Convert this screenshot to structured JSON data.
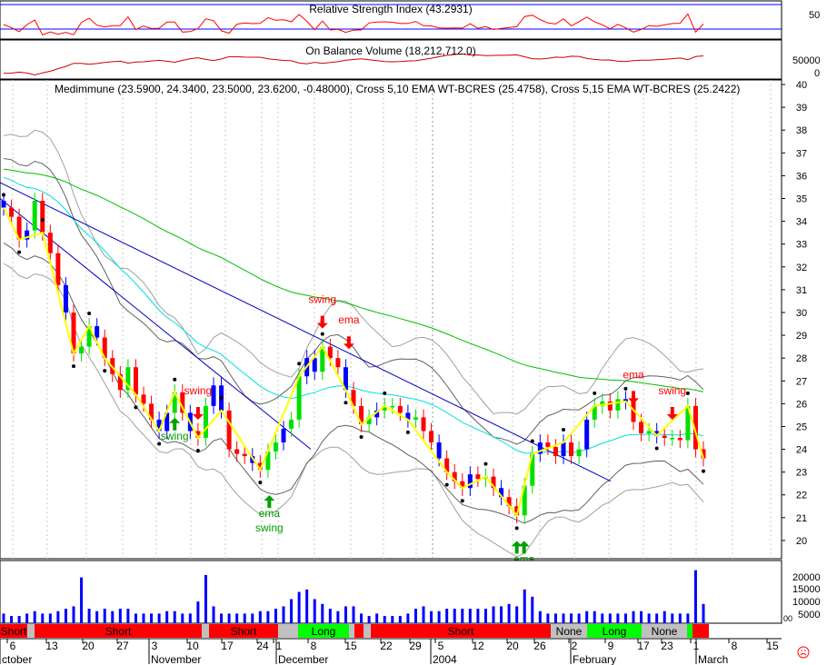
{
  "panels": {
    "rsi": {
      "title": "Relative Strength Index (43.2931)",
      "ticks": [
        "50"
      ]
    },
    "obv": {
      "title": "On Balance Volume (18,212,712.0)",
      "ticks": [
        "50000",
        "0"
      ]
    },
    "price": {
      "title": "Medimmune (23.5900, 24.3400, 23.5000, 23.6200, -0.48000), Cross 5,10 EMA WT-BCRES (25.4758), Cross 5,15 EMA WT-BCRES (25.2422)"
    },
    "volume": {
      "ticks": [
        "20000",
        "15000",
        "10000",
        "5000",
        "00"
      ]
    }
  },
  "signal_bar": {
    "segments": [
      {
        "label": "Short",
        "state": "short"
      },
      {
        "label": "",
        "state": "none"
      },
      {
        "label": "Short",
        "state": "short"
      },
      {
        "label": "",
        "state": "none"
      },
      {
        "label": "Short",
        "state": "short"
      },
      {
        "label": "",
        "state": "none"
      },
      {
        "label": "Long",
        "state": "long"
      },
      {
        "label": "",
        "state": "none"
      },
      {
        "label": "",
        "state": "short"
      },
      {
        "label": "",
        "state": "none"
      },
      {
        "label": "Short",
        "state": "short"
      },
      {
        "label": "None",
        "state": "none"
      },
      {
        "label": "Long",
        "state": "long"
      },
      {
        "label": "None",
        "state": "none"
      },
      {
        "label": "",
        "state": "long"
      },
      {
        "label": "",
        "state": "short"
      }
    ],
    "colors": {
      "short": "#ff0000",
      "long": "#00ff00",
      "none": "#c0c0c0"
    }
  },
  "date_axis": {
    "day_labels": [
      "6",
      "13",
      "20",
      "27",
      "3",
      "10",
      "17",
      "24",
      "1",
      "8",
      "15",
      "22",
      "29",
      "5",
      "12",
      "20",
      "26",
      "2",
      "9",
      "17",
      "23",
      "1",
      "8",
      "15"
    ],
    "month_labels": [
      "ctober",
      "November",
      "December",
      "2004",
      "February",
      "March"
    ]
  },
  "annotations": [
    {
      "text": "swing",
      "color": "#00a000",
      "direction": "up"
    },
    {
      "text": "swing",
      "color": "#ff0000",
      "direction": "down"
    },
    {
      "text": "ema",
      "color": "#00a000",
      "direction": "up"
    },
    {
      "text": "swing",
      "color": "#00a000",
      "direction": ""
    },
    {
      "text": "swing",
      "color": "#ff0000",
      "direction": "down"
    },
    {
      "text": "ema",
      "color": "#ff0000",
      "direction": "down"
    },
    {
      "text": "ema",
      "color": "#00a000",
      "direction": "up"
    },
    {
      "text": "swing",
      "color": "#00a000",
      "direction": "up"
    },
    {
      "text": "ema",
      "color": "#ff0000",
      "direction": "down"
    },
    {
      "text": "swing",
      "color": "#ff0000",
      "direction": "down"
    }
  ],
  "chart_data": {
    "type": "candlestick",
    "title": "Medimmune (23.5900, 24.3400, 23.5000, 23.6200, -0.48000), Cross 5,10 EMA WT-BCRES (25.4758), Cross 5,15 EMA WT-BCRES (25.2422)",
    "y_ticks": [
      20,
      21,
      22,
      23,
      24,
      25,
      26,
      27,
      28,
      29,
      30,
      31,
      32,
      33,
      34,
      35,
      36,
      37,
      38,
      39,
      40
    ],
    "ylim": [
      19.2,
      40.2
    ],
    "close": [
      34.6,
      34.2,
      33.2,
      33.6,
      34.9,
      33.5,
      32.6,
      31.2,
      30.0,
      28.2,
      28.5,
      29.4,
      28.9,
      28.0,
      27.3,
      26.6,
      27.6,
      26.4,
      26.0,
      25.3,
      24.8,
      25.6,
      26.5,
      25.6,
      24.8,
      24.5,
      25.9,
      26.8,
      25.7,
      24.0,
      23.8,
      23.7,
      23.4,
      23.1,
      23.9,
      24.3,
      24.9,
      25.3,
      27.2,
      28.0,
      27.4,
      28.5,
      28.0,
      27.6,
      26.6,
      25.9,
      25.1,
      25.4,
      25.7,
      25.9,
      25.9,
      25.6,
      25.3,
      25.4,
      24.8,
      24.3,
      23.6,
      23.0,
      22.6,
      22.3,
      22.9,
      22.7,
      22.8,
      22.3,
      21.9,
      21.5,
      21.1,
      22.4,
      23.8,
      24.3,
      24.1,
      23.7,
      24.3,
      23.7,
      24.0,
      25.3,
      25.9,
      26.1,
      25.7,
      26.2,
      26.1,
      25.2,
      24.7,
      24.8,
      24.6,
      24.5,
      24.5,
      24.4,
      25.9,
      24.0,
      23.6
    ],
    "volume": [
      4000,
      3000,
      3000,
      4000,
      5000,
      4000,
      4000,
      5000,
      6000,
      7000,
      19000,
      6000,
      5000,
      6000,
      5000,
      6000,
      6000,
      4000,
      4000,
      4000,
      4000,
      5000,
      5000,
      4000,
      4000,
      9000,
      20000,
      7000,
      4000,
      4000,
      4000,
      4000,
      4000,
      5000,
      5000,
      6000,
      7000,
      10000,
      13000,
      14000,
      10000,
      8000,
      6000,
      5000,
      7000,
      7000,
      4000,
      3000,
      4000,
      3000,
      3000,
      3000,
      4000,
      6000,
      7000,
      5000,
      5000,
      6000,
      6000,
      6000,
      6000,
      6000,
      6000,
      7000,
      7000,
      8000,
      7000,
      14000,
      11000,
      5000,
      4000,
      4000,
      4000,
      4000,
      4000,
      5000,
      5000,
      4000,
      4000,
      4000,
      4000,
      5000,
      5000,
      4000,
      4000,
      5000,
      4000,
      4000,
      4000,
      22000,
      8000
    ],
    "series": [
      {
        "name": "ema_cyan",
        "color": "#00e0e0"
      },
      {
        "name": "ema_green",
        "color": "#00c000"
      },
      {
        "name": "band_dark",
        "color": "#606060"
      },
      {
        "name": "band_light",
        "color": "#a0a0a0"
      },
      {
        "name": "swing",
        "color": "#ffff00"
      },
      {
        "name": "trendline",
        "color": "#0000c0"
      }
    ]
  }
}
